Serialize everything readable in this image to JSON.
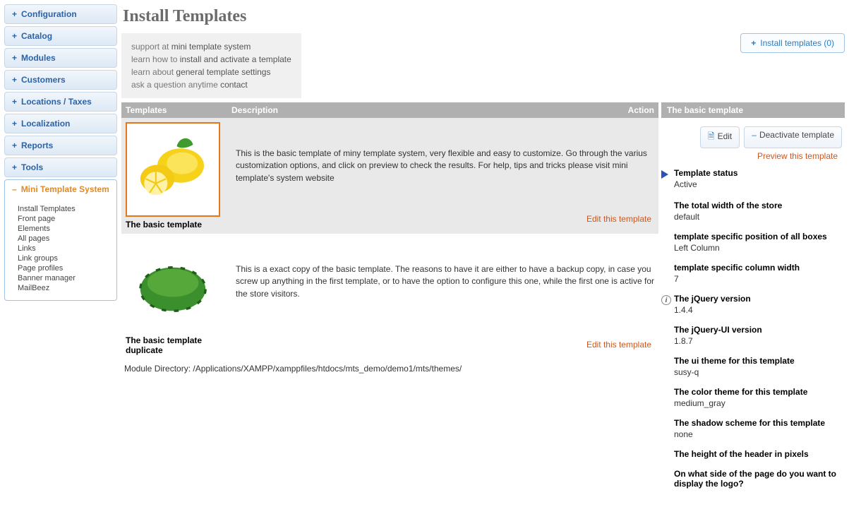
{
  "sidebar": {
    "categories": [
      {
        "label": "Configuration"
      },
      {
        "label": "Catalog"
      },
      {
        "label": "Modules"
      },
      {
        "label": "Customers"
      },
      {
        "label": "Locations / Taxes"
      },
      {
        "label": "Localization"
      },
      {
        "label": "Reports"
      },
      {
        "label": "Tools"
      }
    ],
    "expanded": {
      "label": "Mini Template System",
      "items": [
        "Install Templates",
        "Front page",
        "Elements",
        "All pages",
        "Links",
        "Link groups",
        "Page profiles",
        "Banner manager",
        "MailBeez"
      ]
    }
  },
  "page": {
    "title": "Install Templates",
    "install_button": "Install templates (0)",
    "info": {
      "l1a": "support at ",
      "l1b": "mini template system",
      "l2a": "learn how to ",
      "l2b": "install and activate a template",
      "l3a": "learn about ",
      "l3b": "general template settings",
      "l4a": "ask a question anytime ",
      "l4b": "contact"
    },
    "columns": {
      "templates": "Templates",
      "description": "Description",
      "action": "Action"
    },
    "templates": [
      {
        "name": "The basic template",
        "description": "This is the basic template of miny template system, very flexible and easy to customize. Go through the varius customization options, and click on preview to check the results. For help, tips and tricks please visit mini template's system website",
        "edit": "Edit this template"
      },
      {
        "name": "The basic template duplicate",
        "description": "This is a exact copy of the basic template. The reasons to have it are either to have a backup copy, in case you screw up anything in the first template, or to have the option to configure this one, while the first one is active for the store visitors.",
        "edit": "Edit this template"
      }
    ],
    "module_dir": "Module Directory: /Applications/XAMPP/xamppfiles/htdocs/mts_demo/demo1/mts/themes/"
  },
  "panel": {
    "title": "The basic template",
    "edit_btn": "Edit",
    "deactivate_btn": "Deactivate template",
    "preview": "Preview this template",
    "fields": [
      {
        "label": "Template status",
        "value": "Active",
        "arrow": true
      },
      {
        "label": "The total width of the store",
        "value": "default"
      },
      {
        "label": "template specific position of all boxes",
        "value": "Left Column"
      },
      {
        "label": "template specific column width",
        "value": "7"
      },
      {
        "label": "The jQuery version",
        "value": "1.4.4",
        "info": true
      },
      {
        "label": "The jQuery-UI version",
        "value": "1.8.7"
      },
      {
        "label": "The ui theme for this template",
        "value": "susy-q"
      },
      {
        "label": "The color theme for this template",
        "value": "medium_gray"
      },
      {
        "label": "The shadow scheme for this template",
        "value": "none"
      },
      {
        "label": "The height of the header in pixels",
        "value": ""
      },
      {
        "label": "On what side of the page do you want to display the logo?",
        "value": ""
      }
    ]
  }
}
